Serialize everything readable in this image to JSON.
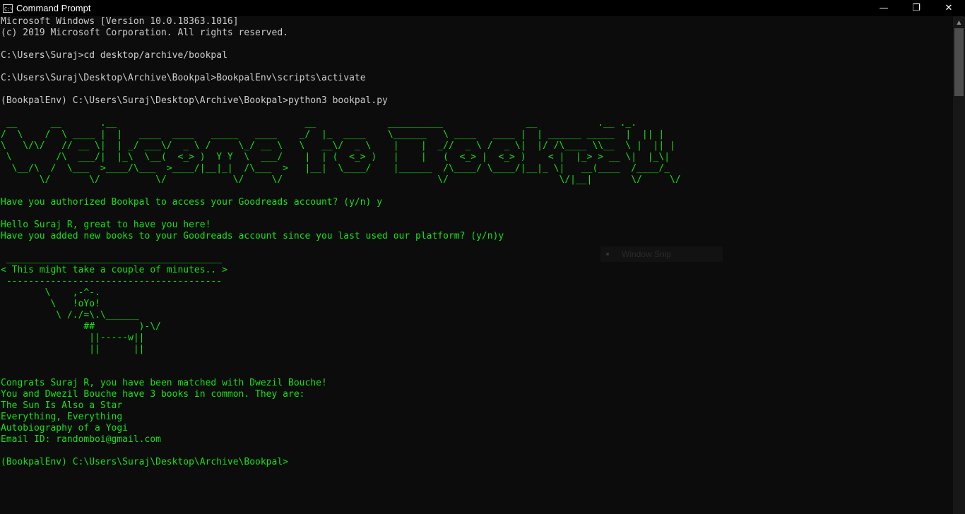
{
  "titlebar": {
    "icon_text": "C:\\",
    "title": "Command Prompt",
    "minimize": "—",
    "restore": "❐",
    "close": "✕"
  },
  "console": {
    "lines": [
      {
        "text": "Microsoft Windows [Version 10.0.18363.1016]",
        "color": "#cccccc"
      },
      {
        "text": "(c) 2019 Microsoft Corporation. All rights reserved.",
        "color": "#cccccc"
      },
      {
        "text": "",
        "color": "#cccccc"
      },
      {
        "text": "C:\\Users\\Suraj>cd desktop/archive/bookpal",
        "color": "#cccccc"
      },
      {
        "text": "",
        "color": "#cccccc"
      },
      {
        "text": "C:\\Users\\Suraj\\Desktop\\Archive\\Bookpal>BookpalEnv\\scripts\\activate",
        "color": "#cccccc"
      },
      {
        "text": "",
        "color": "#cccccc"
      },
      {
        "text": "(BookpalEnv) C:\\Users\\Suraj\\Desktop\\Archive\\Bookpal>python3 bookpal.py",
        "color": "#cccccc"
      },
      {
        "text": "",
        "color": "#13e313"
      },
      {
        "text": " __      __       .__                                  __             __________               __           .__ ._.",
        "color": "#13e313"
      },
      {
        "text": "/  \\    /  \\ ____ |  |   ____  ____   _____   ____    _/  |_  ____    \\______   \\ ____   ____ |  | ______ _____  |  || |",
        "color": "#13e313"
      },
      {
        "text": "\\   \\/\\/   // __ \\|  | _/ ___\\/  _ \\ /     \\_/ __ \\   \\   __\\/  _ \\    |    |  _//  _ \\ /  _ \\|  |/ /\\____ \\\\__  \\ |  || |",
        "color": "#13e313"
      },
      {
        "text": " \\        /\\  ___/|  |_\\  \\__(  <_> )  Y Y  \\  ___/    |  | (  <_> )   |    |   (  <_> |  <_> )    < |  |_> > __ \\|  |_\\|",
        "color": "#13e313"
      },
      {
        "text": "  \\__/\\  /  \\___  >____/\\___  >____/|__|_|  /\\___  >   |__|  \\____/    |______  /\\____/ \\____/|__|_ \\|   __(____  /____/_",
        "color": "#13e313"
      },
      {
        "text": "       \\/       \\/          \\/            \\/     \\/                            \\/                    \\/|__|       \\/     \\/",
        "color": "#13e313"
      },
      {
        "text": "",
        "color": "#13e313"
      },
      {
        "text": "Have you authorized Bookpal to access your Goodreads account? (y/n) y",
        "color": "#13e313"
      },
      {
        "text": "",
        "color": "#13e313"
      },
      {
        "text": "Hello Suraj R, great to have you here!",
        "color": "#13e313"
      },
      {
        "text": "Have you added new books to your Goodreads account since you last used our platform? (y/n)y",
        "color": "#13e313"
      },
      {
        "text": "",
        "color": "#13e313"
      },
      {
        "text": " _______________________________________",
        "color": "#13e313"
      },
      {
        "text": "< This might take a couple of minutes.. >",
        "color": "#13e313"
      },
      {
        "text": " ---------------------------------------",
        "color": "#13e313"
      },
      {
        "text": "        \\    ,-^-.",
        "color": "#13e313"
      },
      {
        "text": "         \\   !oYo!",
        "color": "#13e313"
      },
      {
        "text": "          \\ /./=\\.\\______",
        "color": "#13e313"
      },
      {
        "text": "               ##        )-\\/",
        "color": "#13e313"
      },
      {
        "text": "                ||-----w||",
        "color": "#13e313"
      },
      {
        "text": "                ||      ||",
        "color": "#13e313"
      },
      {
        "text": "",
        "color": "#13e313"
      },
      {
        "text": "",
        "color": "#13e313"
      },
      {
        "text": "Congrats Suraj R, you have been matched with Dwezil Bouche!",
        "color": "#13e313"
      },
      {
        "text": "You and Dwezil Bouche have 3 books in common. They are:",
        "color": "#13e313"
      },
      {
        "text": "The Sun Is Also a Star",
        "color": "#13e313"
      },
      {
        "text": "Everything, Everything",
        "color": "#13e313"
      },
      {
        "text": "Autobiography of a Yogi",
        "color": "#13e313"
      },
      {
        "text": "Email ID: randomboi@gmail.com",
        "color": "#13e313"
      },
      {
        "text": "",
        "color": "#13e313"
      },
      {
        "text": "(BookpalEnv) C:\\Users\\Suraj\\Desktop\\Archive\\Bookpal>",
        "color": "#13e313"
      }
    ]
  },
  "overlay": {
    "snip_label": "Window Snip",
    "snip_icon": "window-snip-icon"
  },
  "scrollbar": {
    "up_arrow": "▲"
  }
}
